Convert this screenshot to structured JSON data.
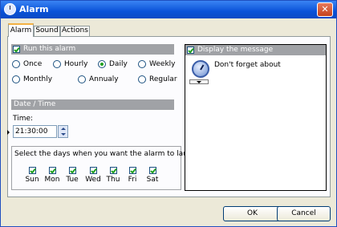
{
  "window": {
    "title": "Alarm"
  },
  "tabs": [
    {
      "label": "Alarm",
      "active": true
    },
    {
      "label": "Sound",
      "active": false
    },
    {
      "label": "Actions",
      "active": false
    }
  ],
  "run": {
    "label": "Run this alarm",
    "checked": true,
    "options": [
      {
        "label": "Once",
        "selected": false
      },
      {
        "label": "Hourly",
        "selected": false
      },
      {
        "label": "Daily",
        "selected": true
      },
      {
        "label": "Weekly",
        "selected": false
      },
      {
        "label": "Monthly",
        "selected": false
      },
      {
        "label": "Annualy",
        "selected": false
      },
      {
        "label": "Regular",
        "selected": false
      }
    ]
  },
  "datetime": {
    "header": "Date / Time",
    "time_label": "Time:",
    "time_value": "21:30:00"
  },
  "days": {
    "prompt": "Select the days when you want the alarm to launch:",
    "items": [
      {
        "label": "Sun",
        "checked": true
      },
      {
        "label": "Mon",
        "checked": true
      },
      {
        "label": "Tue",
        "checked": true
      },
      {
        "label": "Wed",
        "checked": true
      },
      {
        "label": "Thu",
        "checked": true
      },
      {
        "label": "Fri",
        "checked": true
      },
      {
        "label": "Sat",
        "checked": true
      }
    ]
  },
  "message": {
    "header": "Display the message",
    "checked": true,
    "text": "Don't forget about"
  },
  "buttons": {
    "ok": "OK",
    "cancel": "Cancel"
  },
  "colors": {
    "title_bar": "#0a52d8",
    "check": "#21a121",
    "group_header": "#a0a2a6"
  }
}
